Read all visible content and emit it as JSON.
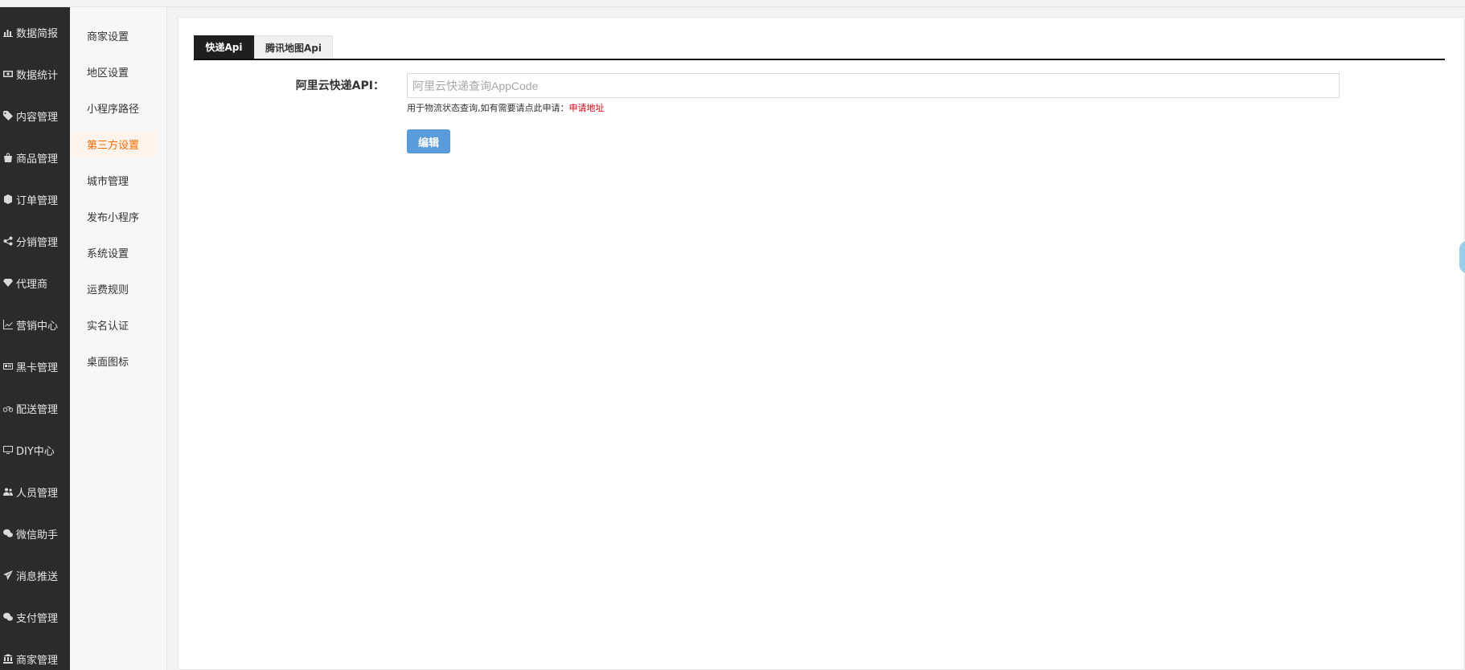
{
  "sidebar": {
    "items": [
      {
        "label": "数据简报",
        "icon": "bar-chart-icon"
      },
      {
        "label": "数据统计",
        "icon": "money-icon"
      },
      {
        "label": "内容管理",
        "icon": "tag-icon"
      },
      {
        "label": "商品管理",
        "icon": "bag-icon"
      },
      {
        "label": "订单管理",
        "icon": "cube-icon"
      },
      {
        "label": "分销管理",
        "icon": "share-icon"
      },
      {
        "label": "代理商",
        "icon": "diamond-icon"
      },
      {
        "label": "营销中心",
        "icon": "line-chart-icon"
      },
      {
        "label": "黑卡管理",
        "icon": "card-icon"
      },
      {
        "label": "配送管理",
        "icon": "bike-icon"
      },
      {
        "label": "DIY中心",
        "icon": "monitor-icon"
      },
      {
        "label": "人员管理",
        "icon": "users-icon"
      },
      {
        "label": "微信助手",
        "icon": "wechat-icon"
      },
      {
        "label": "消息推送",
        "icon": "paper-plane-icon"
      },
      {
        "label": "支付管理",
        "icon": "wechat-icon"
      },
      {
        "label": "商家管理",
        "icon": "bank-icon"
      }
    ]
  },
  "submenu": {
    "items": [
      {
        "label": "商家设置"
      },
      {
        "label": "地区设置"
      },
      {
        "label": "小程序路径"
      },
      {
        "label": "第三方设置",
        "active": true
      },
      {
        "label": "城市管理"
      },
      {
        "label": "发布小程序"
      },
      {
        "label": "系统设置"
      },
      {
        "label": "运费规则"
      },
      {
        "label": "实名认证"
      },
      {
        "label": "桌面图标"
      }
    ]
  },
  "tabs": [
    {
      "label": "快递Api",
      "active": true
    },
    {
      "label": "腾讯地图Api",
      "active": false
    }
  ],
  "form": {
    "label": "阿里云快递API：",
    "placeholder": "阿里云快递查询AppCode",
    "value": "",
    "help_text": "用于物流状态查询,如有需要请点此申请：",
    "help_link": "申请地址",
    "edit_button": "编辑"
  },
  "colors": {
    "sidebar_bg": "#2b2b2b",
    "active_orange": "#ff6a00",
    "button_blue": "#5a9bdc",
    "link_red": "#e60012"
  }
}
